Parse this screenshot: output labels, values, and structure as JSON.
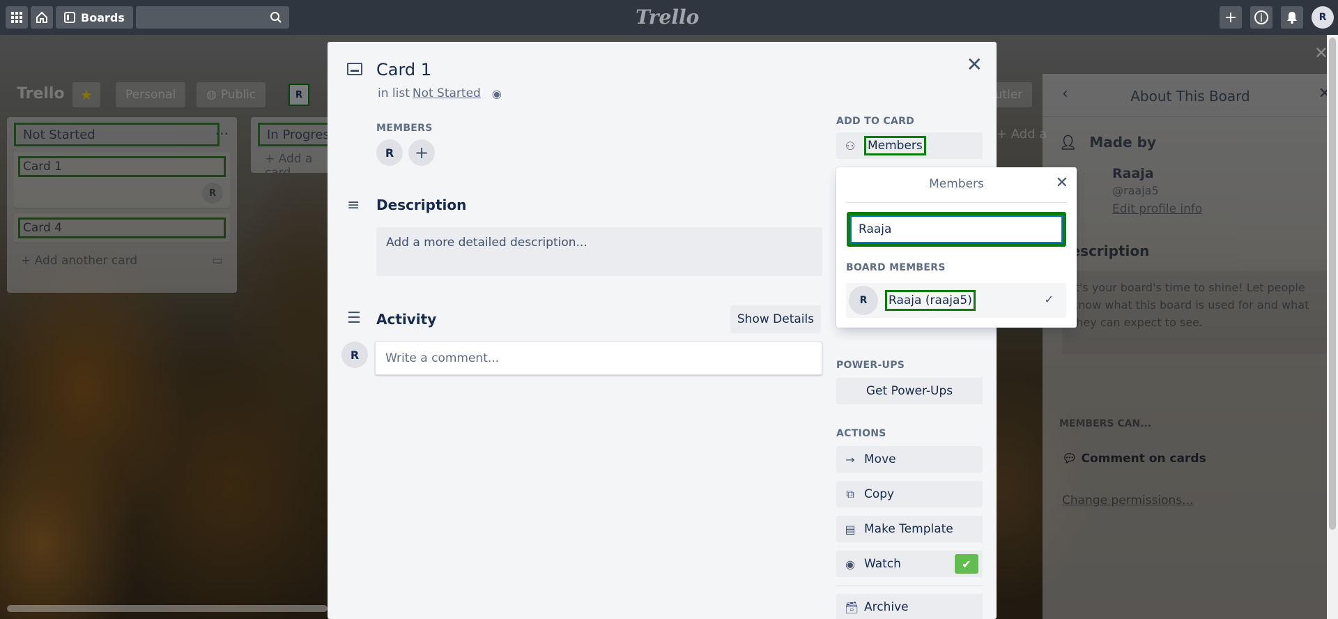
{
  "topbar": {
    "boards_label": "Boards",
    "logo_text": "Trello",
    "avatar_initial": "R"
  },
  "board": {
    "title": "Trello",
    "visibility_personal": "Personal",
    "visibility_public": "Public",
    "member_initial": "R",
    "butler_label": "Butler",
    "add_another_list": "+ Add a"
  },
  "lists": [
    {
      "title": "Not Started",
      "cards": [
        {
          "title": "Card 1",
          "member": "R"
        },
        {
          "title": "Card 4",
          "member": ""
        }
      ],
      "add_card": "Add another card"
    },
    {
      "title": "In Progress",
      "add_card": "Add a card"
    }
  ],
  "sidebar": {
    "title": "About This Board",
    "made_by": "Made by",
    "name": "Raaja",
    "handle": "@raaja5",
    "edit_profile": "Edit profile info",
    "description_heading": "Description",
    "description_text": "It's your board's time to shine! Let people know what this board is used for and what they can expect to see.",
    "members_can": "MEMBERS CAN...",
    "comment_on_cards": "Comment on cards",
    "change_permissions": "Change permissions..."
  },
  "modal": {
    "title": "Card 1",
    "in_list_prefix": "in list",
    "list_name": "Not Started",
    "members_label": "MEMBERS",
    "member_initial": "R",
    "description_heading": "Description",
    "description_placeholder": "Add a more detailed description...",
    "activity_heading": "Activity",
    "show_details": "Show Details",
    "comment_placeholder": "Write a comment...",
    "commenter_initial": "R",
    "add_to_card_label": "ADD TO CARD",
    "members_button": "Members",
    "power_ups_label": "POWER-UPS",
    "get_power_ups": "Get Power-Ups",
    "actions_label": "ACTIONS",
    "actions": {
      "move": "Move",
      "copy": "Copy",
      "make_template": "Make Template",
      "watch": "Watch",
      "archive": "Archive"
    }
  },
  "popover": {
    "title": "Members",
    "search_value": "Raaja",
    "board_members_label": "BOARD MEMBERS",
    "member_initial": "R",
    "member_name": "Raaja (raaja5)"
  }
}
